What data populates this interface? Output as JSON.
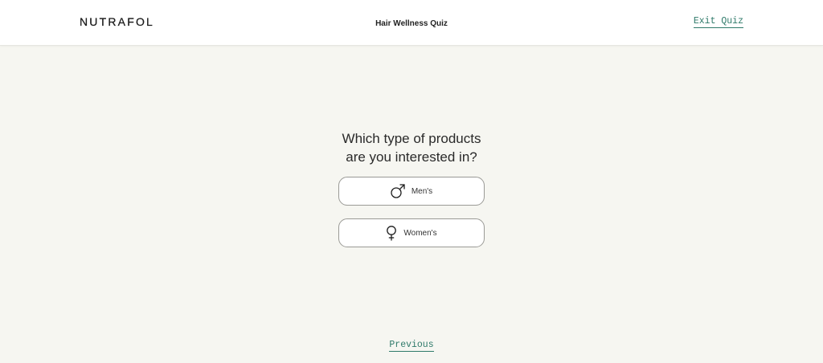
{
  "header": {
    "logo": "NUTRAFOL",
    "title": "Hair Wellness Quiz",
    "exit_label": "Exit Quiz"
  },
  "quiz": {
    "question_line1": "Which type of products",
    "question_line2": "are you interested in?",
    "options": [
      {
        "label": "Men's",
        "icon": "male-symbol-icon"
      },
      {
        "label": "Women's",
        "icon": "female-symbol-icon"
      }
    ]
  },
  "footer": {
    "previous_label": "Previous"
  },
  "colors": {
    "background": "#f6f6f1",
    "link": "#2f7a6a",
    "header_bg": "#ffffff"
  }
}
